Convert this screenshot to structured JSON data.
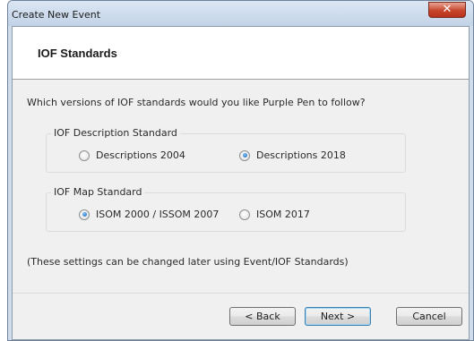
{
  "window": {
    "title": "Create New Event",
    "close_glyph": "✕"
  },
  "page": {
    "title": "IOF Standards",
    "question": "Which versions of IOF standards would you like Purple Pen to follow?",
    "footnote": "(These settings can be changed later using Event/IOF Standards)"
  },
  "description_standard": {
    "label": "IOF Description Standard",
    "options": [
      {
        "label": "Descriptions 2004",
        "checked": false
      },
      {
        "label": "Descriptions 2018",
        "checked": true
      }
    ]
  },
  "map_standard": {
    "label": "IOF Map Standard",
    "options": [
      {
        "label": "ISOM 2000 / ISSOM 2007",
        "checked": true
      },
      {
        "label": "ISOM 2017",
        "checked": false
      }
    ]
  },
  "buttons": {
    "back": "< Back",
    "next": "Next >",
    "cancel": "Cancel"
  }
}
